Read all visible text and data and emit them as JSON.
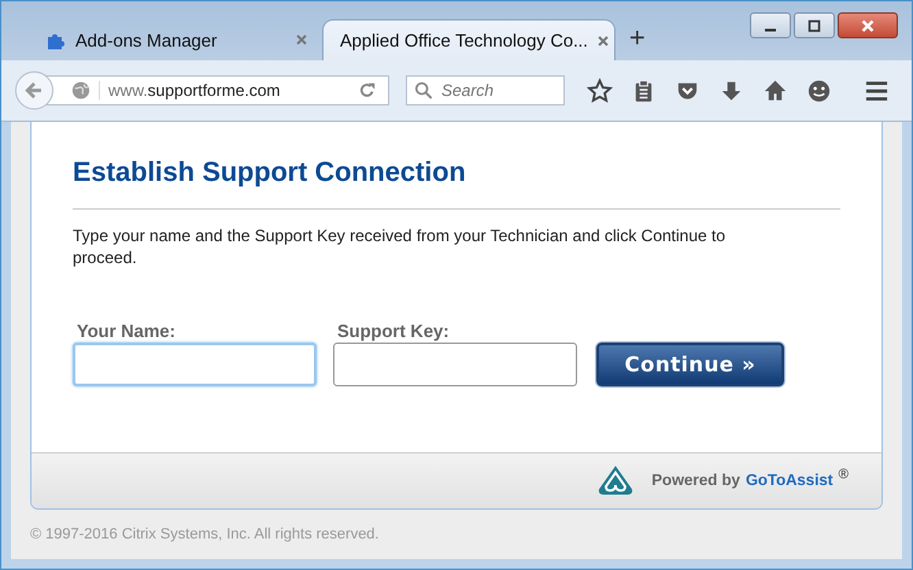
{
  "tabs": [
    {
      "title": "Add-ons Manager",
      "selected": false,
      "kind": "addon"
    },
    {
      "title": "Applied Office Technology Co...",
      "selected": true,
      "kind": "page"
    }
  ],
  "new_tab": "+",
  "toolbar": {
    "url_prefix": "www.",
    "url_domain": "supportforme.com",
    "search": {
      "placeholder": "Search"
    }
  },
  "page": {
    "title": "Establish Support Connection",
    "instructions": "Type your name and the Support Key received from your Technician and click Continue to proceed.",
    "fields": [
      {
        "label": "Your Name:",
        "focused": true
      },
      {
        "label": "Support Key:",
        "focused": false
      }
    ],
    "button": "Continue »",
    "footer": {
      "powered": "Powered by",
      "brand": "GoToAssist",
      "mark": "®"
    },
    "copyright": "© 1997-2016 Citrix Systems, Inc. All rights reserved."
  }
}
